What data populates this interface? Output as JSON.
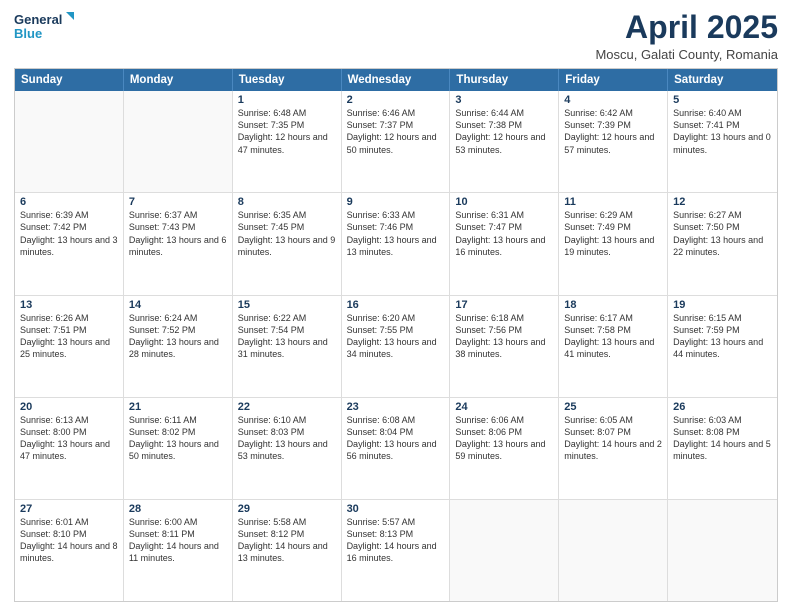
{
  "header": {
    "logo_line1": "General",
    "logo_line2": "Blue",
    "title": "April 2025",
    "subtitle": "Moscu, Galati County, Romania"
  },
  "days_of_week": [
    "Sunday",
    "Monday",
    "Tuesday",
    "Wednesday",
    "Thursday",
    "Friday",
    "Saturday"
  ],
  "weeks": [
    [
      {
        "day": "",
        "text": ""
      },
      {
        "day": "",
        "text": ""
      },
      {
        "day": "1",
        "text": "Sunrise: 6:48 AM\nSunset: 7:35 PM\nDaylight: 12 hours and 47 minutes."
      },
      {
        "day": "2",
        "text": "Sunrise: 6:46 AM\nSunset: 7:37 PM\nDaylight: 12 hours and 50 minutes."
      },
      {
        "day": "3",
        "text": "Sunrise: 6:44 AM\nSunset: 7:38 PM\nDaylight: 12 hours and 53 minutes."
      },
      {
        "day": "4",
        "text": "Sunrise: 6:42 AM\nSunset: 7:39 PM\nDaylight: 12 hours and 57 minutes."
      },
      {
        "day": "5",
        "text": "Sunrise: 6:40 AM\nSunset: 7:41 PM\nDaylight: 13 hours and 0 minutes."
      }
    ],
    [
      {
        "day": "6",
        "text": "Sunrise: 6:39 AM\nSunset: 7:42 PM\nDaylight: 13 hours and 3 minutes."
      },
      {
        "day": "7",
        "text": "Sunrise: 6:37 AM\nSunset: 7:43 PM\nDaylight: 13 hours and 6 minutes."
      },
      {
        "day": "8",
        "text": "Sunrise: 6:35 AM\nSunset: 7:45 PM\nDaylight: 13 hours and 9 minutes."
      },
      {
        "day": "9",
        "text": "Sunrise: 6:33 AM\nSunset: 7:46 PM\nDaylight: 13 hours and 13 minutes."
      },
      {
        "day": "10",
        "text": "Sunrise: 6:31 AM\nSunset: 7:47 PM\nDaylight: 13 hours and 16 minutes."
      },
      {
        "day": "11",
        "text": "Sunrise: 6:29 AM\nSunset: 7:49 PM\nDaylight: 13 hours and 19 minutes."
      },
      {
        "day": "12",
        "text": "Sunrise: 6:27 AM\nSunset: 7:50 PM\nDaylight: 13 hours and 22 minutes."
      }
    ],
    [
      {
        "day": "13",
        "text": "Sunrise: 6:26 AM\nSunset: 7:51 PM\nDaylight: 13 hours and 25 minutes."
      },
      {
        "day": "14",
        "text": "Sunrise: 6:24 AM\nSunset: 7:52 PM\nDaylight: 13 hours and 28 minutes."
      },
      {
        "day": "15",
        "text": "Sunrise: 6:22 AM\nSunset: 7:54 PM\nDaylight: 13 hours and 31 minutes."
      },
      {
        "day": "16",
        "text": "Sunrise: 6:20 AM\nSunset: 7:55 PM\nDaylight: 13 hours and 34 minutes."
      },
      {
        "day": "17",
        "text": "Sunrise: 6:18 AM\nSunset: 7:56 PM\nDaylight: 13 hours and 38 minutes."
      },
      {
        "day": "18",
        "text": "Sunrise: 6:17 AM\nSunset: 7:58 PM\nDaylight: 13 hours and 41 minutes."
      },
      {
        "day": "19",
        "text": "Sunrise: 6:15 AM\nSunset: 7:59 PM\nDaylight: 13 hours and 44 minutes."
      }
    ],
    [
      {
        "day": "20",
        "text": "Sunrise: 6:13 AM\nSunset: 8:00 PM\nDaylight: 13 hours and 47 minutes."
      },
      {
        "day": "21",
        "text": "Sunrise: 6:11 AM\nSunset: 8:02 PM\nDaylight: 13 hours and 50 minutes."
      },
      {
        "day": "22",
        "text": "Sunrise: 6:10 AM\nSunset: 8:03 PM\nDaylight: 13 hours and 53 minutes."
      },
      {
        "day": "23",
        "text": "Sunrise: 6:08 AM\nSunset: 8:04 PM\nDaylight: 13 hours and 56 minutes."
      },
      {
        "day": "24",
        "text": "Sunrise: 6:06 AM\nSunset: 8:06 PM\nDaylight: 13 hours and 59 minutes."
      },
      {
        "day": "25",
        "text": "Sunrise: 6:05 AM\nSunset: 8:07 PM\nDaylight: 14 hours and 2 minutes."
      },
      {
        "day": "26",
        "text": "Sunrise: 6:03 AM\nSunset: 8:08 PM\nDaylight: 14 hours and 5 minutes."
      }
    ],
    [
      {
        "day": "27",
        "text": "Sunrise: 6:01 AM\nSunset: 8:10 PM\nDaylight: 14 hours and 8 minutes."
      },
      {
        "day": "28",
        "text": "Sunrise: 6:00 AM\nSunset: 8:11 PM\nDaylight: 14 hours and 11 minutes."
      },
      {
        "day": "29",
        "text": "Sunrise: 5:58 AM\nSunset: 8:12 PM\nDaylight: 14 hours and 13 minutes."
      },
      {
        "day": "30",
        "text": "Sunrise: 5:57 AM\nSunset: 8:13 PM\nDaylight: 14 hours and 16 minutes."
      },
      {
        "day": "",
        "text": ""
      },
      {
        "day": "",
        "text": ""
      },
      {
        "day": "",
        "text": ""
      }
    ]
  ]
}
